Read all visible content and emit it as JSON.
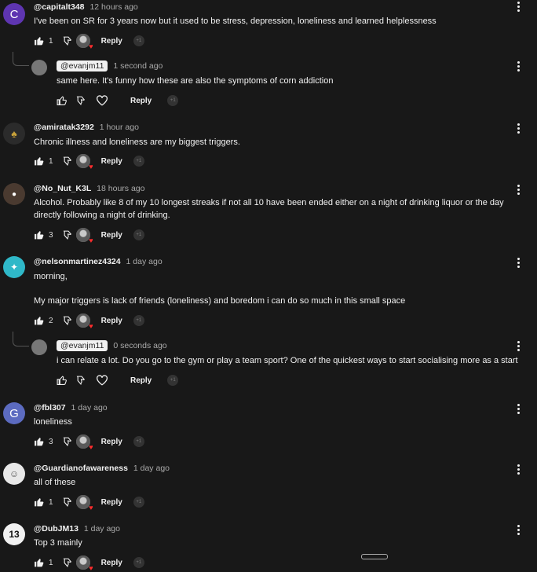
{
  "comments": [
    {
      "author": "@capitalt348",
      "time": "12 hours ago",
      "text": "I've been on SR for 3 years now but it used to be stress, depression, loneliness  and learned helplessness",
      "likes": "1",
      "reply": "Reply",
      "avatar_letter": "C",
      "avatar_color": "#5e35b1"
    },
    {
      "author": "@evanjm11",
      "time": "1 second ago",
      "text": "same here. It's funny how these are also the symptoms of corn addiction",
      "likes": "",
      "reply": "Reply"
    },
    {
      "author": "@amiratak3292",
      "time": "1 hour ago",
      "text": "Chronic illness and loneliness are my biggest triggers.",
      "likes": "1",
      "reply": "Reply"
    },
    {
      "author": "@No_Nut_K3L",
      "time": "18 hours ago",
      "text": "Alcohol. Probably like 8 of my 10 longest streaks if not all 10 have been ended either on a night of drinking liquor or the day directly following a night of drinking.",
      "likes": "3",
      "reply": "Reply"
    },
    {
      "author": "@nelsonmartinez4324",
      "time": "1 day ago",
      "text_line1": "morning,",
      "text_line2": "My major triggers is lack of friends (loneliness) and boredom i can do so much in this small space",
      "likes": "2",
      "reply": "Reply"
    },
    {
      "author": "@evanjm11",
      "time": "0 seconds ago",
      "text": "i can relate a lot. Do you go to the gym or play a team sport? One of the quickest ways to start socialising more as a start",
      "likes": "",
      "reply": "Reply"
    },
    {
      "author": "@fbl307",
      "time": "1 day ago",
      "text": "loneliness",
      "likes": "3",
      "reply": "Reply",
      "avatar_letter": "G",
      "avatar_color": "#5c6bc0"
    },
    {
      "author": "@Guardianofawareness",
      "time": "1 day ago",
      "text": "all of these",
      "likes": "1",
      "reply": "Reply"
    },
    {
      "author": "@DubJM13",
      "time": "1 day ago",
      "text": "Top 3 mainly",
      "likes": "1",
      "reply": "Reply"
    }
  ],
  "icons": {
    "like": "thumbs-up-icon",
    "dislike": "thumbs-down-icon",
    "heart": "heart-icon",
    "menu": "more-vertical-icon",
    "plus_one": "plus-one-icon"
  },
  "plus_one_label": "+1"
}
